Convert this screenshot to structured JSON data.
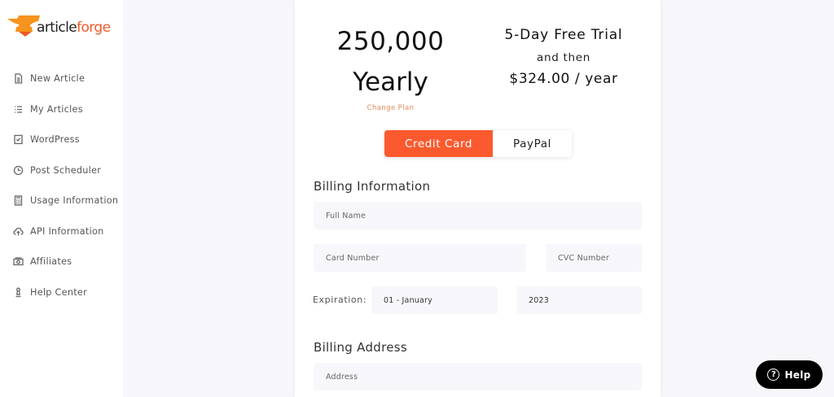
{
  "brand": {
    "name_part1": "article",
    "name_part2": "forge",
    "accent_color": "#f05a28"
  },
  "sidebar": {
    "items": [
      {
        "label": "New Article",
        "icon": "document-icon"
      },
      {
        "label": "My Articles",
        "icon": "list-icon"
      },
      {
        "label": "WordPress",
        "icon": "checkbox-icon"
      },
      {
        "label": "Post Scheduler",
        "icon": "clock-icon"
      },
      {
        "label": "Usage Information",
        "icon": "calculator-icon"
      },
      {
        "label": "API Information",
        "icon": "cloud-upload-icon"
      },
      {
        "label": "Affiliates",
        "icon": "money-icon"
      },
      {
        "label": "Help Center",
        "icon": "chess-pawn-icon"
      }
    ]
  },
  "plan": {
    "count": "250,000",
    "period": "Yearly",
    "change_label": "Change Plan"
  },
  "trial": {
    "title": "5-Day Free Trial",
    "then": "and then",
    "price": "$324.00 / year"
  },
  "payment_toggle": {
    "active": "Credit Card",
    "inactive": "PayPal",
    "active_color": "#fa5a2e"
  },
  "billing_info": {
    "title": "Billing Information",
    "full_name_placeholder": "Full Name",
    "card_number_placeholder": "Card Number",
    "cvc_placeholder": "CVC Number",
    "expiration_label": "Expiration:",
    "month_value": "01 - January",
    "year_value": "2023"
  },
  "billing_address": {
    "title": "Billing Address",
    "address_placeholder": "Address"
  },
  "help_button": {
    "label": "Help",
    "icon": "question-circle-icon"
  }
}
